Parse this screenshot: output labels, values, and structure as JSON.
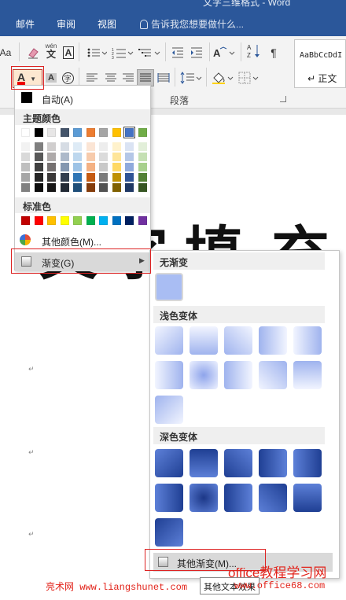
{
  "window": {
    "title": "文字三维格式 - Word"
  },
  "tabs": [
    {
      "label": "邮件"
    },
    {
      "label": "审阅"
    },
    {
      "label": "视图"
    }
  ],
  "tell_me": {
    "placeholder": "告诉我您想要做什么..."
  },
  "ribbon": {
    "font_size_label": "Aa",
    "phonetic_label": "wén",
    "paragraph_group_label": "段落",
    "style_sample": "AaBbCcDdI",
    "style_name": "↵ 正文",
    "font_color_letter": "A"
  },
  "color_menu": {
    "auto_label": "自动(A)",
    "theme_header": "主题颜色",
    "theme_colors": [
      "#ffffff",
      "#000000",
      "#e7e6e6",
      "#44546a",
      "#5b9bd5",
      "#ed7d31",
      "#a5a5a5",
      "#ffc000",
      "#4472c4",
      "#70ad47"
    ],
    "theme_tints": [
      [
        "#f2f2f2",
        "#d9d9d9",
        "#bfbfbf",
        "#a6a6a6",
        "#808080"
      ],
      [
        "#7f7f7f",
        "#595959",
        "#404040",
        "#262626",
        "#0d0d0d"
      ],
      [
        "#d0cece",
        "#aeaaaa",
        "#757070",
        "#3a3838",
        "#171616"
      ],
      [
        "#d6dce4",
        "#adb9ca",
        "#8497b0",
        "#333f4f",
        "#222a35"
      ],
      [
        "#deebf6",
        "#bdd7ee",
        "#9dc3e6",
        "#2e75b5",
        "#1e4e79"
      ],
      [
        "#fbe5d5",
        "#f7cbac",
        "#f4b183",
        "#c55a11",
        "#843c0b"
      ],
      [
        "#ededed",
        "#dbdbdb",
        "#c9c9c9",
        "#7b7b7b",
        "#525252"
      ],
      [
        "#fff2cc",
        "#fee599",
        "#ffd965",
        "#bf9000",
        "#7f6000"
      ],
      [
        "#dae3f3",
        "#b4c7e7",
        "#8faadc",
        "#2f5496",
        "#1f3864"
      ],
      [
        "#e2efd9",
        "#c5e0b3",
        "#a8d08d",
        "#538135",
        "#375623"
      ]
    ],
    "standard_header": "标准色",
    "standard_colors": [
      "#c00000",
      "#ff0000",
      "#ffc000",
      "#ffff00",
      "#92d050",
      "#00b050",
      "#00b0f0",
      "#0070c0",
      "#002060",
      "#7030a0"
    ],
    "more_colors_label": "其他颜色(M)...",
    "gradient_label": "渐变(G)"
  },
  "gradient_menu": {
    "none_header": "无渐变",
    "light_header": "浅色变体",
    "dark_header": "深色变体",
    "more_label": "其他渐变(M)...",
    "light_variants": [
      "linear-gradient(135deg, #f2f5ff 0%, #9fb3ee 100%)",
      "linear-gradient(180deg, #f2f5ff 0%, #9fb3ee 100%)",
      "linear-gradient(225deg, #f2f5ff 0%, #9fb3ee 100%)",
      "linear-gradient(90deg, #9fb3ee 0%, #f2f5ff 100%)",
      "linear-gradient(270deg, #9fb3ee 0%, #f2f5ff 100%)",
      "linear-gradient(90deg, #f2f5ff 0%, #9fb3ee 100%)",
      "radial-gradient(circle, #8ea4eb 0%, #eef2ff 100%)",
      "linear-gradient(270deg, #f2f5ff 0%, #9fb3ee 100%)",
      "linear-gradient(45deg, #f2f5ff 0%, #9fb3ee 100%)",
      "linear-gradient(0deg, #f2f5ff 0%, #9fb3ee 100%)",
      "linear-gradient(315deg, #f2f5ff 0%, #9fb3ee 100%)"
    ],
    "dark_variants": [
      "linear-gradient(135deg, #5d80d8 0%, #1f3f93 100%)",
      "linear-gradient(180deg, #1f3f93 0%, #5d80d8 100%)",
      "linear-gradient(225deg, #5d80d8 0%, #1f3f93 100%)",
      "linear-gradient(90deg, #1f3f93 0%, #5d80d8 100%)",
      "linear-gradient(270deg, #1f3f93 0%, #5d80d8 100%)",
      "linear-gradient(90deg, #5d80d8 0%, #1f3f93 100%)",
      "radial-gradient(circle, #1c3787 0%, #5d80d8 100%)",
      "linear-gradient(270deg, #5d80d8 0%, #1f3f93 100%)",
      "linear-gradient(45deg, #5d80d8 0%, #1f3f93 100%)",
      "linear-gradient(0deg, #1f3f93 0%, #5d80d8 100%)",
      "linear-gradient(315deg, #5d80d8 0%, #1f3f93 100%)"
    ]
  },
  "watermark": {
    "left_site_name": "亮术网",
    "left_url": "www.liangshunet.com",
    "tooltip": "其他文本效果",
    "right_title": "office教程学习网",
    "right_url": "www.office68.com"
  },
  "document": {
    "visible_chars": [
      "文",
      "字",
      "填",
      "充"
    ]
  }
}
